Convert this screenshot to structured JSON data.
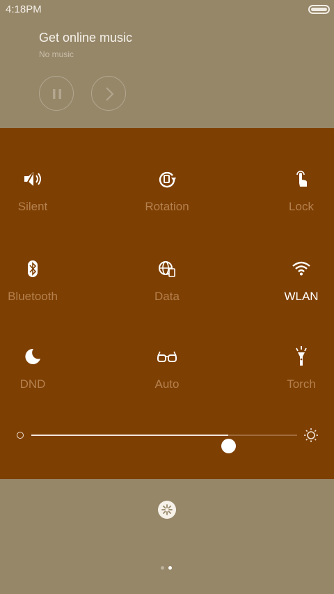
{
  "status_bar": {
    "time": "4:18PM",
    "battery_icon": "battery-icon"
  },
  "music": {
    "title": "Get online music",
    "subtitle": "No music",
    "pause_icon": "pause-icon",
    "next_icon": "chevron-right-icon"
  },
  "toggles": [
    {
      "label": "Silent",
      "icon": "speaker-icon",
      "active": false
    },
    {
      "label": "Rotation",
      "icon": "rotation-lock-icon",
      "active": false
    },
    {
      "label": "Lock",
      "icon": "touch-lock-icon",
      "active": false
    },
    {
      "label": "Bluetooth",
      "icon": "bluetooth-icon",
      "active": false
    },
    {
      "label": "Data",
      "icon": "mobile-data-icon",
      "active": false
    },
    {
      "label": "WLAN",
      "icon": "wifi-icon",
      "active": true
    },
    {
      "label": "DND",
      "icon": "moon-icon",
      "active": false
    },
    {
      "label": "Auto",
      "icon": "glasses-icon",
      "active": false
    },
    {
      "label": "Torch",
      "icon": "flashlight-icon",
      "active": false
    }
  ],
  "brightness": {
    "level": 0.74,
    "min_icon": "brightness-low-icon",
    "max_icon": "sun-icon"
  },
  "settings": {
    "icon": "settings-icon"
  },
  "pager": {
    "count": 2,
    "current": 2
  },
  "colors": {
    "background": "#968769",
    "panel": "#7e3f02",
    "label_inactive": "#b4814f",
    "label_active": "#ffffff"
  }
}
